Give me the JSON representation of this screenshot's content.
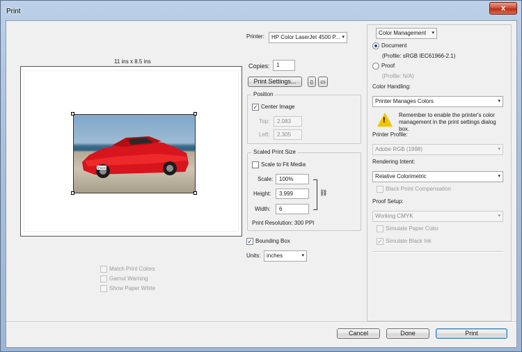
{
  "window": {
    "title": "Print",
    "close_label": "x"
  },
  "preview": {
    "paper_size": "11 ins x 8.5 ins",
    "photo_plate": "PHOTO"
  },
  "printer": {
    "label": "Printer:",
    "value": "HP Color LaserJet 4500 P..."
  },
  "copies": {
    "label": "Copies:",
    "value": "1"
  },
  "print_settings_label": "Print Settings...",
  "position": {
    "title": "Position",
    "center_image_label": "Center Image",
    "center_image_checked": "✓",
    "top_label": "Top:",
    "top_value": "2.083",
    "left_label": "Left:",
    "left_value": "2.305"
  },
  "scaled": {
    "title": "Scaled Print Size",
    "fit_label": "Scale to Fit Media",
    "scale_label": "Scale:",
    "scale_value": "100%",
    "height_label": "Height:",
    "height_value": "3.999",
    "width_label": "Width:",
    "width_value": "6",
    "resolution": "Print Resolution: 300 PPI"
  },
  "bounding_box": {
    "label": "Bounding Box",
    "checked": "✓"
  },
  "units": {
    "label": "Units:",
    "value": "inches"
  },
  "options": {
    "match_print_colors": "Match Print Colors",
    "gamut_warning": "Gamut Warning",
    "show_paper_white": "Show Paper White"
  },
  "color_mgmt": {
    "section_select": "Color Management",
    "document_label": "Document",
    "document_profile": "(Profile: sRGB IEC61966-2.1)",
    "proof_label": "Proof",
    "proof_profile": "(Profile: N/A)",
    "handling_label": "Color Handling:",
    "handling_value": "Printer Manages Colors",
    "warning_text": "Remember to enable the printer's color management in the print settings dialog box.",
    "printer_profile_label": "Printer Profile:",
    "printer_profile_value": "Adobe RGB (1998)",
    "rendering_intent_label": "Rendering Intent:",
    "rendering_intent_value": "Relative Colorimetric",
    "black_point_label": "Black Point Compensation",
    "proof_setup_label": "Proof Setup:",
    "proof_setup_value": "Working CMYK",
    "simulate_paper_label": "Simulate Paper Color",
    "simulate_black_label": "Simulate Black Ink",
    "simulate_black_checked": "✓"
  },
  "buttons": {
    "cancel": "Cancel",
    "done": "Done",
    "print": "Print"
  },
  "icons": {
    "chain": "⛓",
    "dropdown": "▾"
  },
  "colors": {
    "titlebar": "#a9c1dc",
    "close": "#c9442b",
    "warning": "#f2c200"
  }
}
